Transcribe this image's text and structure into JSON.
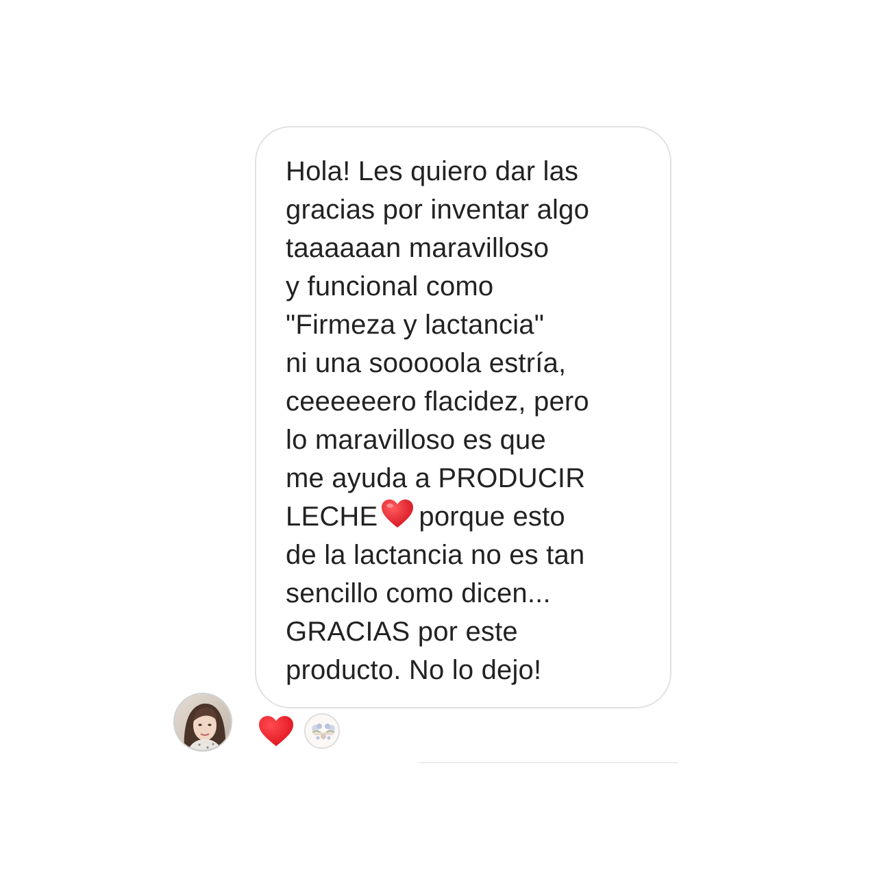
{
  "message": {
    "lines": [
      "Hola! Les quiero dar las",
      "gracias por inventar algo",
      "taaaaaan maravilloso",
      "y funcional como",
      "\"Firmeza y lactancia\"",
      "ni una sooooola estría,",
      "ceeeeeero flacidez, pero",
      "lo maravilloso es que",
      "me ayuda a PRODUCIR"
    ],
    "heart_line_before": "LECHE",
    "heart_line_after": "porque esto",
    "lines_after": [
      "de la lactancia no es tan",
      "sencillo como dicen...",
      "GRACIAS por este",
      "producto. No lo dejo!"
    ]
  },
  "icons": {
    "inline": "red-heart-emoji-icon",
    "reaction": "red-heart-reaction-icon",
    "avatar": "sender-avatar",
    "reactor": "reactor-avatar"
  },
  "colors": {
    "text": "#222222",
    "bubble_border": "#e2e2e2",
    "heart": "#e8212d"
  }
}
